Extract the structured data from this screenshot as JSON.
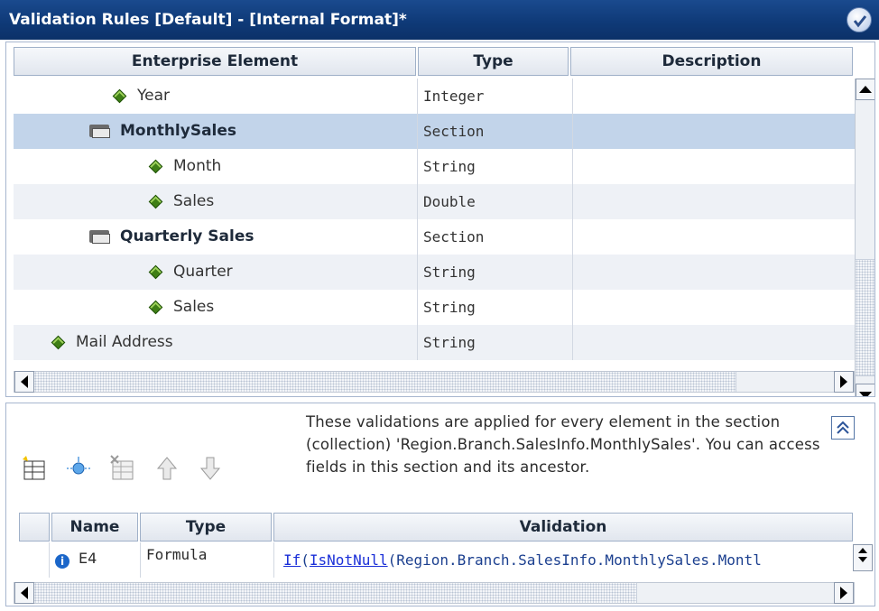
{
  "window": {
    "title": "Validation Rules [Default] - [Internal Format]*"
  },
  "element_grid": {
    "columns": [
      "Enterprise Element",
      "Type",
      "Description"
    ],
    "rows": [
      {
        "name": "Year",
        "type": "Integer",
        "description": "",
        "kind": "field",
        "level": 2
      },
      {
        "name": "MonthlySales",
        "type": "Section",
        "description": "",
        "kind": "section",
        "level": 2,
        "selected": true
      },
      {
        "name": "Month",
        "type": "String",
        "description": "",
        "kind": "field",
        "level": 3
      },
      {
        "name": "Sales",
        "type": "Double",
        "description": "",
        "kind": "field",
        "level": 3
      },
      {
        "name": "Quarterly Sales",
        "type": "Section",
        "description": "",
        "kind": "section",
        "level": 2
      },
      {
        "name": "Quarter",
        "type": "String",
        "description": "",
        "kind": "field",
        "level": 3
      },
      {
        "name": "Sales",
        "type": "String",
        "description": "",
        "kind": "field",
        "level": 3
      },
      {
        "name": "Mail Address",
        "type": "String",
        "description": "",
        "kind": "field",
        "level": 1
      }
    ],
    "vscroll_position": 0.62,
    "hscroll_position": 0.0
  },
  "validation_panel": {
    "toolbar": [
      "add-validation-icon",
      "add-item-icon",
      "delete-validation-icon",
      "move-up-icon",
      "move-down-icon"
    ],
    "note": "These validations are applied for every element in the section (collection) 'Region.Branch.SalesInfo.MonthlySales'. You can access fields in this section and its ancestor.",
    "columns": [
      "Name",
      "Type",
      "Validation"
    ],
    "rows": [
      {
        "name": "E4",
        "type": "Formula",
        "validation_keyword": "If",
        "validation_func": "IsNotNull",
        "validation_rest": "(Region.Branch.SalesInfo.MonthlySales.Montl"
      }
    ]
  }
}
